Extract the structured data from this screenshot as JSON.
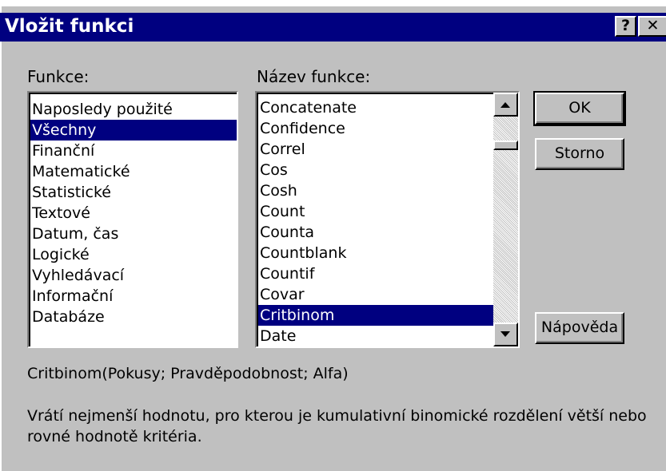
{
  "window": {
    "title": "Vložit funkci",
    "help_glyph": "?",
    "close_glyph": "✕"
  },
  "categories": {
    "label": "Funkce:",
    "selected_index": 1,
    "items": [
      "Naposledy použité",
      "Všechny",
      "Finanční",
      "Matematické",
      "Statistické",
      "Textové",
      "Datum, čas",
      "Logické",
      "Vyhledávací",
      "Informační",
      "Databáze"
    ]
  },
  "functions": {
    "label": "Název funkce:",
    "selected_index": 10,
    "items": [
      "Concatenate",
      "Confidence",
      "Correl",
      "Cos",
      "Cosh",
      "Count",
      "Counta",
      "Countblank",
      "Countif",
      "Covar",
      "Critbinom",
      "Date"
    ]
  },
  "buttons": {
    "ok": "OK",
    "cancel": "Storno",
    "help": "Nápověda"
  },
  "syntax": "Critbinom(Pokusy; Pravděpodobnost; Alfa)",
  "description": "Vrátí nejmenší hodnotu, pro kterou je kumulativní binomické rozdělení větší nebo rovné hodnotě kritéria.",
  "icons": {
    "scroll_up": "triangle-up-icon",
    "scroll_down": "triangle-down-icon"
  }
}
